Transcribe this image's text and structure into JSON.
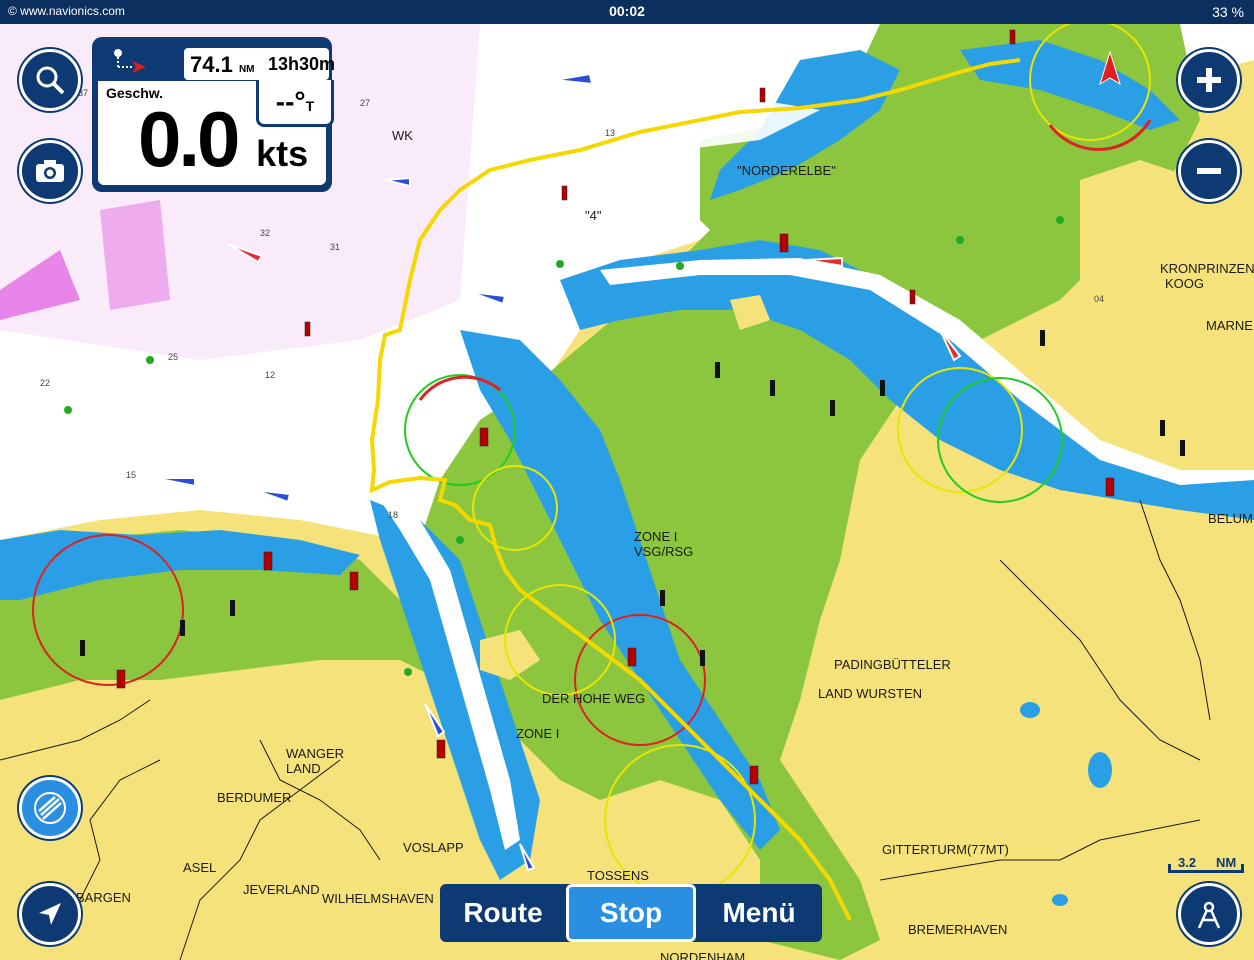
{
  "status_bar": {
    "source": "© www.navionics.com",
    "time": "00:02",
    "battery": "33 %"
  },
  "panel": {
    "distance_value": "74.1",
    "distance_unit": "NM",
    "time_value": "13h30m",
    "speed_label": "Geschw.",
    "speed_value": "0.0",
    "speed_unit": "kts",
    "course_value": "--°",
    "course_suffix": "T"
  },
  "buttons": {
    "route": "Route",
    "stop": "Stop",
    "menu": "Menü"
  },
  "scale": {
    "value": "3.2",
    "unit": "NM"
  },
  "places": [
    "NORDERELBE",
    "KRONPRINZEN KOOG",
    "MARNE",
    "ZONE I VSG/RSG",
    "PADINGBÜTTELER",
    "LAND WURSTEN",
    "DER HOHE WEG",
    "ZONE I",
    "WANGER LAND",
    "BERDUMER",
    "VOSLAPP",
    "ASEL",
    "JEVERLAND",
    "WILHELMSHAVEN",
    "GITTERTURM(77MT)",
    "BREMERHAVEN",
    "BELUM",
    "TOSSENS",
    "BARGEN",
    "NORDENHAM"
  ],
  "colors": {
    "land": "#f6e27a",
    "tidal_flat": "#8cc63f",
    "shallow_water": "#2b9fe6",
    "deep_water": "#ffffff",
    "route": "#f5d800",
    "ui_dark": "#0d3a73",
    "ui_active": "#2a8fe0"
  },
  "icons": [
    "search-icon",
    "camera-icon",
    "zoom-in-icon",
    "zoom-out-icon",
    "navionics-logo-icon",
    "location-arrow-icon",
    "compass-icon",
    "boat-marker-icon"
  ]
}
